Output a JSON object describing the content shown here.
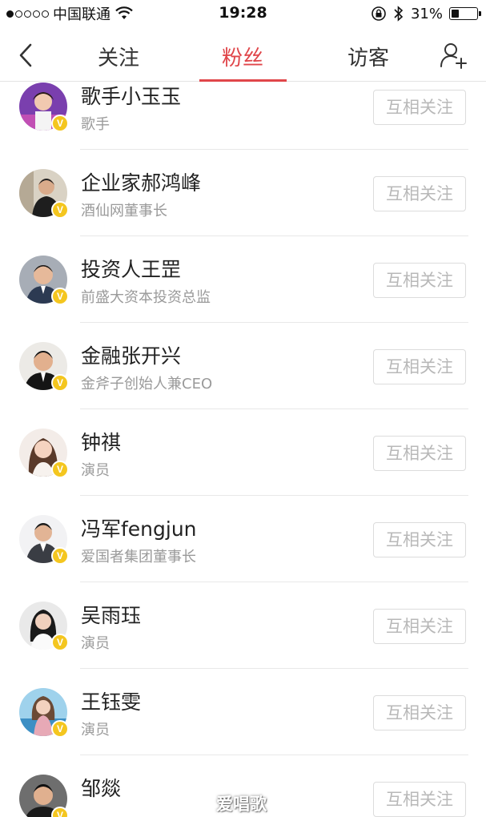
{
  "status_bar": {
    "carrier": "中国联通",
    "time": "19:28",
    "battery": "31%",
    "battery_level": 0.31
  },
  "nav": {
    "tabs": [
      {
        "label": "关注",
        "active": false
      },
      {
        "label": "粉丝",
        "active": true
      },
      {
        "label": "访客",
        "active": false
      }
    ],
    "icons": {
      "back": "chevron-left-icon",
      "add_user": "add-user-icon"
    },
    "accent_color": "#e0464a"
  },
  "fans": [
    {
      "name": "歌手小玉玉",
      "desc": "歌手",
      "verified": true,
      "button": "互相关注"
    },
    {
      "name": "企业家郝鸿峰",
      "desc": "酒仙网董事长",
      "verified": true,
      "button": "互相关注"
    },
    {
      "name": "投资人王罡",
      "desc": "前盛大资本投资总监",
      "verified": true,
      "button": "互相关注"
    },
    {
      "name": "金融张开兴",
      "desc": "金斧子创始人兼CEO",
      "verified": true,
      "button": "互相关注"
    },
    {
      "name": "钟祺",
      "desc": "演员",
      "verified": true,
      "button": "互相关注"
    },
    {
      "name": "冯军fengjun",
      "desc": "爱国者集团董事长",
      "verified": true,
      "button": "互相关注"
    },
    {
      "name": "吴雨珏",
      "desc": "演员",
      "verified": true,
      "button": "互相关注"
    },
    {
      "name": "王钰雯",
      "desc": "演员",
      "verified": true,
      "button": "互相关注"
    },
    {
      "name": "邹燚",
      "desc": "",
      "verified": true,
      "button": "互相关注"
    }
  ],
  "watermark": "爱唱歌"
}
